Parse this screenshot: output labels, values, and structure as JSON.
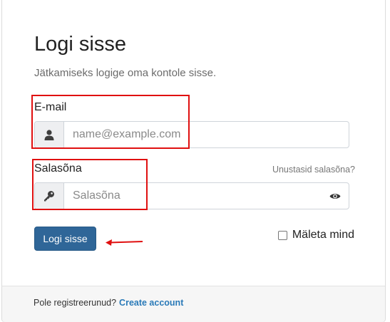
{
  "login": {
    "title": "Logi sisse",
    "subtitle": "Jätkamiseks logige oma kontole sisse.",
    "email_label": "E-mail",
    "email_placeholder": "name@example.com",
    "password_label": "Salasõna",
    "password_placeholder": "Salasõna",
    "forgot_link": "Unustasid salasõna?",
    "submit_label": "Logi sisse",
    "remember_label": "Mäleta mind",
    "remember_checked": false
  },
  "footer": {
    "prompt": "Pole registreerunud?",
    "link": "Create account"
  },
  "icons": {
    "email_addon": "user-icon",
    "password_addon": "key-icon",
    "toggle_visibility": "eye-icon"
  },
  "colors": {
    "primary_button": "#2f6698",
    "link": "#2a7ab8",
    "annotation": "#e01010"
  }
}
